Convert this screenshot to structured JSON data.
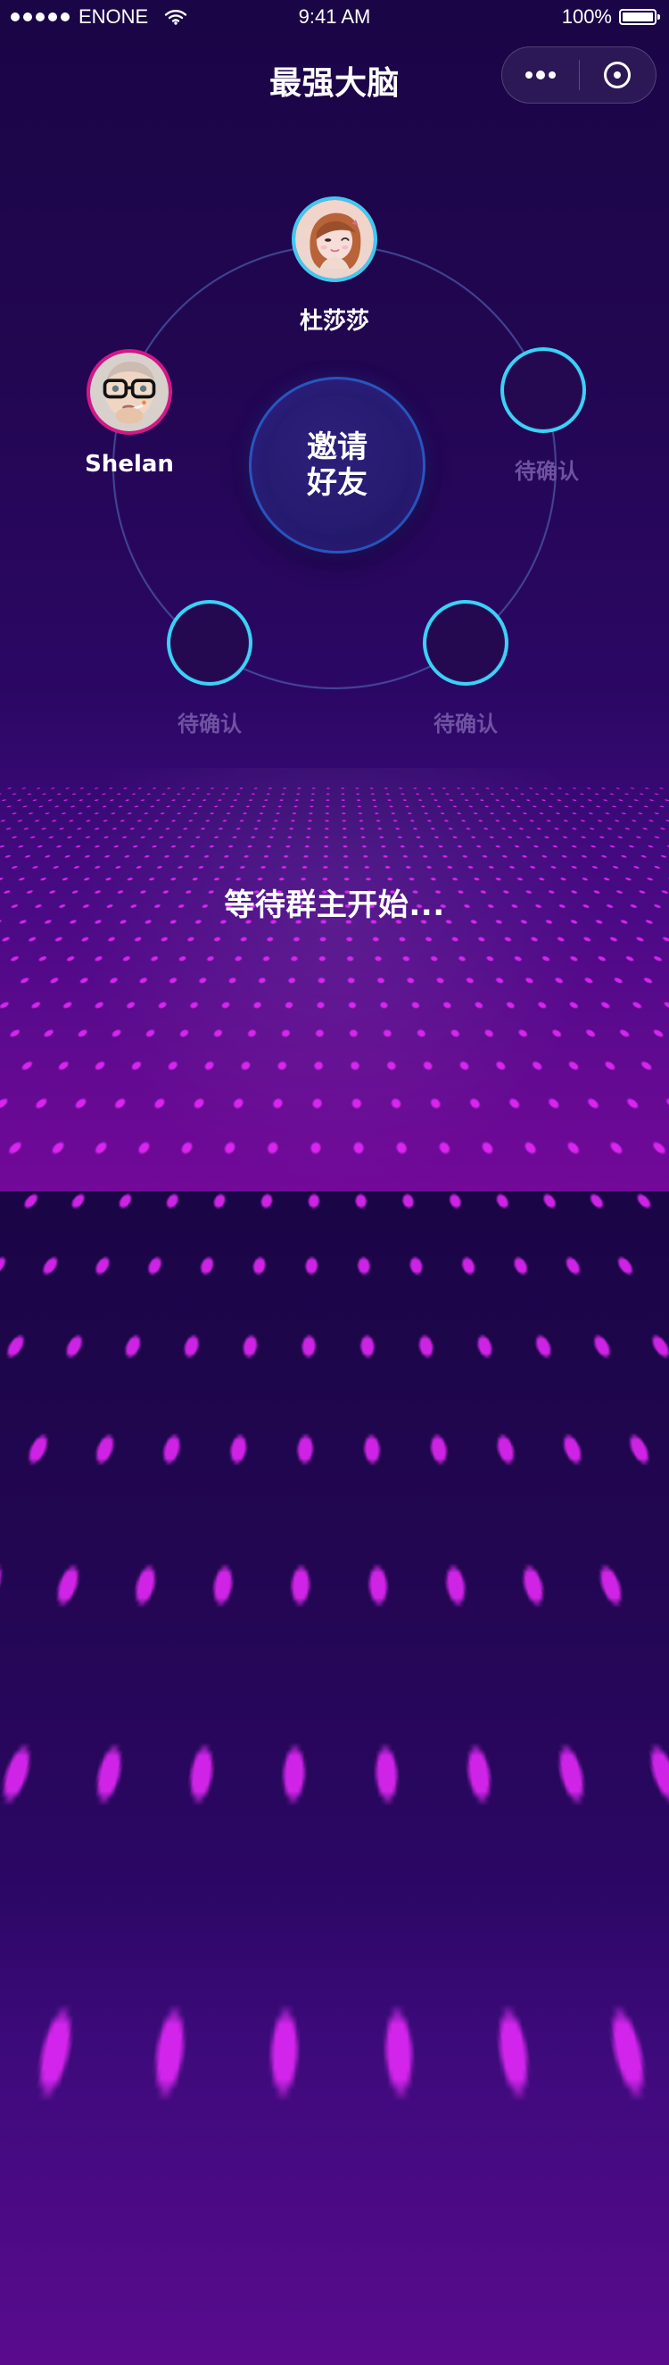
{
  "status_bar": {
    "carrier": "ENONE",
    "time": "9:41 AM",
    "battery": "100%"
  },
  "header": {
    "title": "最强大脑"
  },
  "center_action": {
    "label": "邀请\n好友"
  },
  "players": [
    {
      "name": "杜莎莎",
      "status": "joined",
      "border_color": "#40c8f1"
    },
    {
      "name": "Shelan",
      "status": "joined",
      "border_color": "#d51688"
    },
    {
      "name": "待确认",
      "status": "pending",
      "border_color": "#3ad2f6"
    },
    {
      "name": "待确认",
      "status": "pending",
      "border_color": "#3ad2f6"
    },
    {
      "name": "待确认",
      "status": "pending",
      "border_color": "#3ad2f6"
    }
  ],
  "footer": {
    "message": "等待群主开始..."
  },
  "icons": {
    "more": "more-dots-icon",
    "target": "target-icon",
    "wifi": "wifi-icon",
    "battery": "battery-icon"
  },
  "colors": {
    "background_top": "#1a0546",
    "background_bottom": "#5b0b8f",
    "accent_cyan": "#36ccf2",
    "accent_pink": "#d51688",
    "orbit": "#4d60af",
    "pending_text": "#6f52a2"
  }
}
